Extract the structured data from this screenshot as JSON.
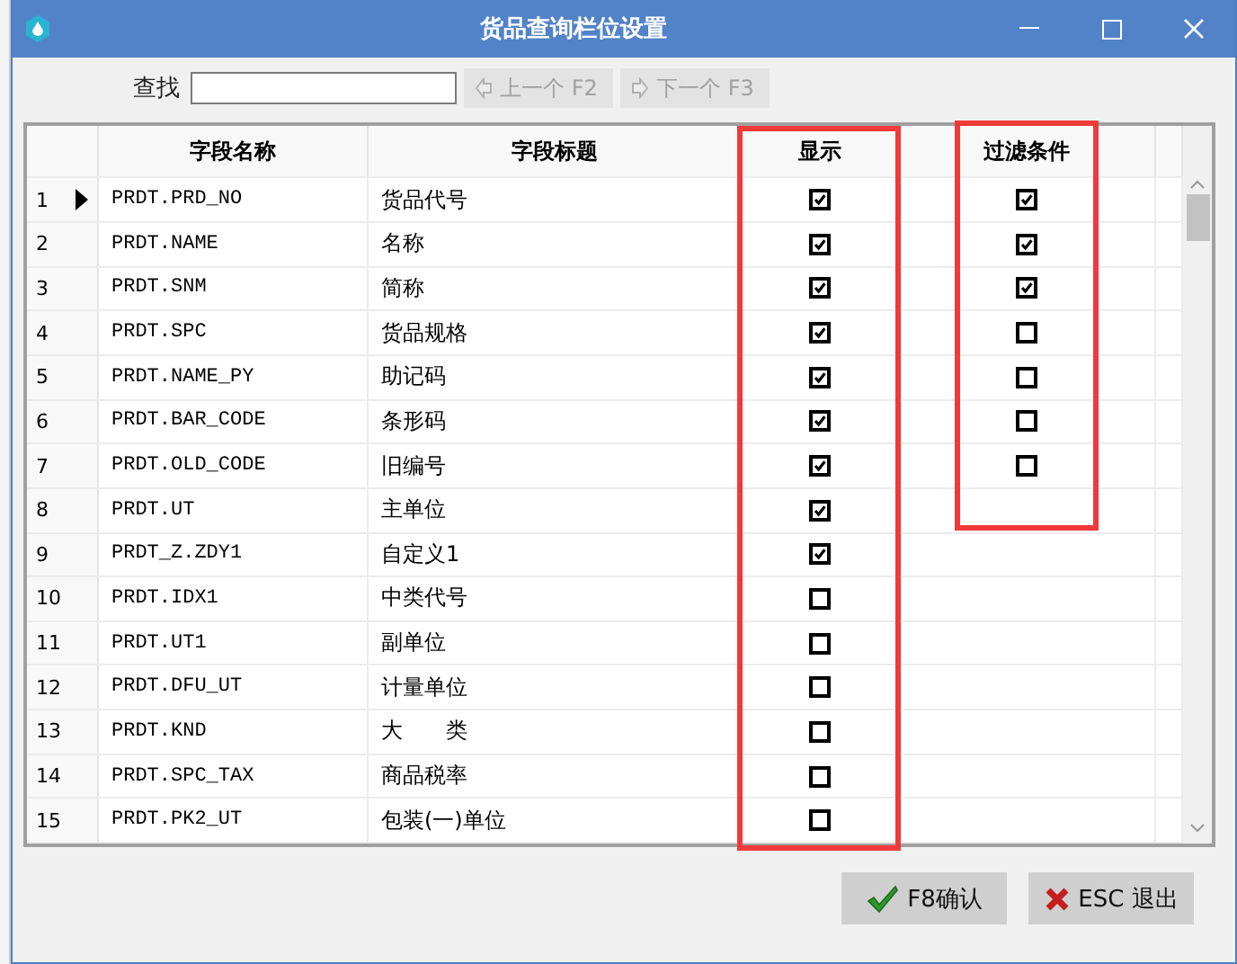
{
  "window": {
    "title": "货品查询栏位设置"
  },
  "search": {
    "label": "查找"
  },
  "nav_buttons": [
    {
      "label": "上一个 F2",
      "kind": "previous",
      "disabled": true
    },
    {
      "label": "下一个 F3",
      "kind": "next",
      "disabled": true
    }
  ],
  "table": {
    "columns": [
      "字段名称",
      "字段标题",
      "显示",
      "过滤条件"
    ],
    "rows": [
      {
        "number": "1",
        "current": true,
        "field": "PRDT.PRD_NO",
        "title": "货品代号",
        "show": true,
        "filter": true
      },
      {
        "number": "2",
        "current": false,
        "field": "PRDT.NAME",
        "title": "名称",
        "show": true,
        "filter": true
      },
      {
        "number": "3",
        "current": false,
        "field": "PRDT.SNM",
        "title": "简称",
        "show": true,
        "filter": true
      },
      {
        "number": "4",
        "current": false,
        "field": "PRDT.SPC",
        "title": "货品规格",
        "show": true,
        "filter": false
      },
      {
        "number": "5",
        "current": false,
        "field": "PRDT.NAME_PY",
        "title": "助记码",
        "show": true,
        "filter": false
      },
      {
        "number": "6",
        "current": false,
        "field": "PRDT.BAR_CODE",
        "title": "条形码",
        "show": true,
        "filter": false
      },
      {
        "number": "7",
        "current": false,
        "field": "PRDT.OLD_CODE",
        "title": "旧编号",
        "show": true,
        "filter": false
      },
      {
        "number": "8",
        "current": false,
        "field": "PRDT.UT",
        "title": "主单位",
        "show": true
      },
      {
        "number": "9",
        "current": false,
        "field": "PRDT_Z.ZDY1",
        "title": "自定义1",
        "show": true
      },
      {
        "number": "10",
        "current": false,
        "field": "PRDT.IDX1",
        "title": "中类代号",
        "show": false
      },
      {
        "number": "11",
        "current": false,
        "field": "PRDT.UT1",
        "title": "副单位",
        "show": false
      },
      {
        "number": "12",
        "current": false,
        "field": "PRDT.DFU_UT",
        "title": "计量单位",
        "show": false
      },
      {
        "number": "13",
        "current": false,
        "field": "PRDT.KND",
        "title": "大　　类",
        "show": false
      },
      {
        "number": "14",
        "current": false,
        "field": "PRDT.SPC_TAX",
        "title": "商品税率",
        "show": false
      },
      {
        "number": "15",
        "current": false,
        "field": "PRDT.PK2_UT",
        "title": "包装(一)单位",
        "show": false
      }
    ]
  },
  "buttons": [
    {
      "kind": "confirm",
      "label": "F8确认"
    },
    {
      "kind": "cancel",
      "label": "ESC 退出"
    }
  ]
}
